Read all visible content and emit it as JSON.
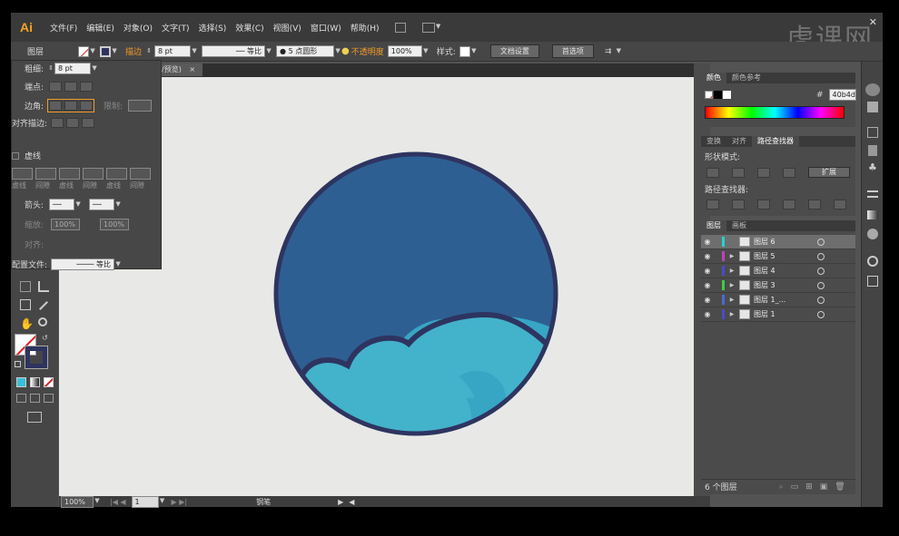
{
  "app": {
    "logo": "Ai",
    "window_close": "✕",
    "watermark": "虎课网"
  },
  "menu": {
    "items": [
      "文件(F)",
      "编辑(E)",
      "对象(O)",
      "文字(T)",
      "选择(S)",
      "效果(C)",
      "视图(V)",
      "窗口(W)",
      "帮助(H)"
    ]
  },
  "control": {
    "selection_label": "图层",
    "stroke_label": "描边",
    "stroke_weight": "8 pt",
    "profile": "等比",
    "brush": "5 点圆形",
    "opacity_label": "不透明度",
    "opacity": "100%",
    "style_label": "样式:",
    "doc_setup": "文档设置",
    "prefs": "首选项"
  },
  "stroke_panel": {
    "weight_label": "粗细:",
    "weight": "8 pt",
    "cap_label": "端点:",
    "corner_label": "边角:",
    "limit_label": "限制:",
    "align_label": "对齐描边:",
    "dashed_label": "虚线",
    "dash_labels": [
      "虚线",
      "间隙",
      "虚线",
      "间隙",
      "虚线",
      "间隙"
    ],
    "arrow_label": "箭头:",
    "scale_label": "缩放:",
    "scale1": "100%",
    "scale2": "100%",
    "align2_label": "对齐:",
    "profile_label": "配置文件:",
    "profile": "等比"
  },
  "document": {
    "tab": "/预览)",
    "tab_close": "×"
  },
  "status": {
    "zoom": "100%",
    "page": "1",
    "tool": "钢笔"
  },
  "color_panel": {
    "tabs": [
      "颜色",
      "颜色参考"
    ],
    "hex_label": "#",
    "hex": "40b4d"
  },
  "pathfinder": {
    "tabs": [
      "变换",
      "对齐",
      "路径查找器"
    ],
    "shape_modes": "形状模式:",
    "expand": "扩展",
    "pathfinders": "路径查找器:"
  },
  "layers_panel": {
    "tabs": [
      "图层",
      "画板"
    ],
    "count": "6 个图层",
    "layers": [
      {
        "name": "图层 6",
        "color": "#1fd4d4",
        "selected": true
      },
      {
        "name": "图层 5",
        "color": "#c040c0",
        "selected": false
      },
      {
        "name": "图层 4",
        "color": "#4a4ad0",
        "selected": false
      },
      {
        "name": "图层 3",
        "color": "#3ed040",
        "selected": false
      },
      {
        "name": "图层 1_...",
        "color": "#4a6ad8",
        "selected": false
      },
      {
        "name": "图层 1",
        "color": "#4a4ad0",
        "selected": false
      }
    ]
  },
  "colors": {
    "sky": "#2e5f93",
    "cloud_back": "#36a6c4",
    "cloud_front": "#43b2cb",
    "outline": "#2e3460"
  }
}
